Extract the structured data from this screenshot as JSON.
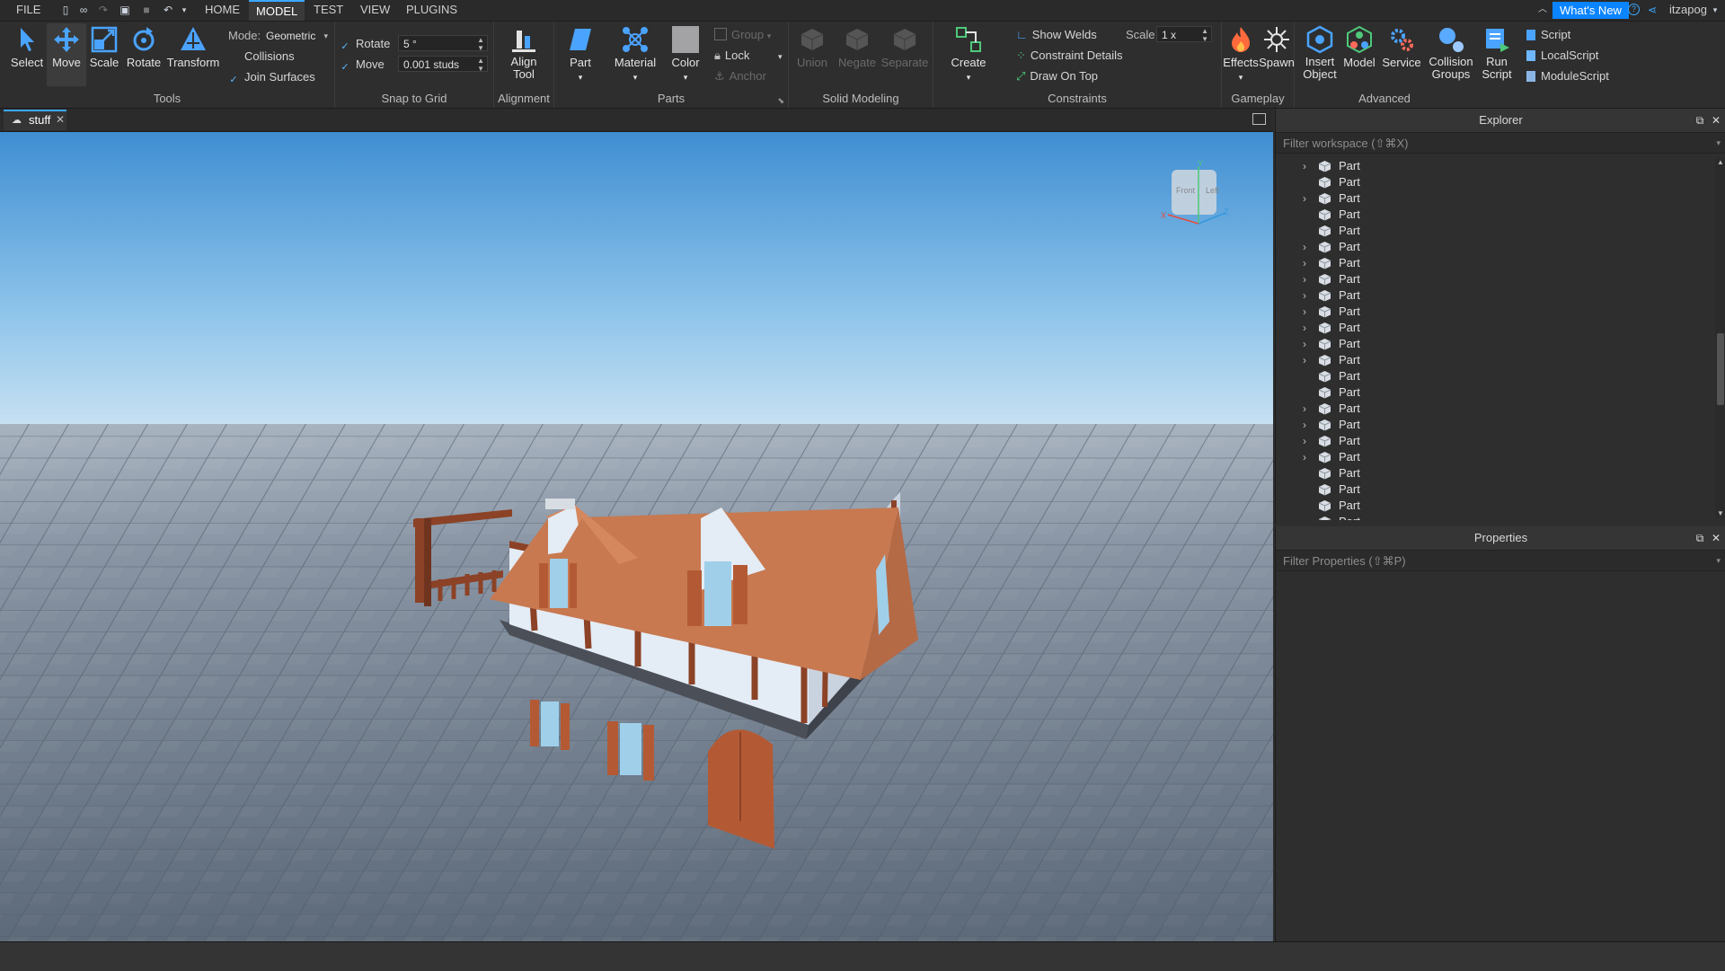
{
  "menubar": {
    "file": "FILE",
    "tabs": [
      "HOME",
      "MODEL",
      "TEST",
      "VIEW",
      "PLUGINS"
    ],
    "active_tab": "MODEL",
    "whats_new": "What's New",
    "username": "itzapog"
  },
  "ribbon": {
    "tools": {
      "label": "Tools",
      "select": "Select",
      "move": "Move",
      "scale": "Scale",
      "rotate": "Rotate",
      "transform": "Transform",
      "mode_label": "Mode:",
      "mode_value": "Geometric",
      "collisions": "Collisions",
      "join_surfaces": "Join Surfaces"
    },
    "snap": {
      "label": "Snap to Grid",
      "rotate_label": "Rotate",
      "rotate_value": "5 °",
      "move_label": "Move",
      "move_value": "0.001 studs"
    },
    "alignment": {
      "label": "Alignment",
      "align_tool_line1": "Align",
      "align_tool_line2": "Tool"
    },
    "parts": {
      "label": "Parts",
      "part": "Part",
      "material": "Material",
      "color": "Color",
      "group": "Group",
      "lock": "Lock",
      "anchor": "Anchor"
    },
    "solid": {
      "label": "Solid Modeling",
      "union": "Union",
      "negate": "Negate",
      "separate": "Separate"
    },
    "constraints": {
      "label": "Constraints",
      "create": "Create",
      "show_welds": "Show Welds",
      "constraint_details": "Constraint Details",
      "draw_on_top": "Draw On Top",
      "scale_label": "Scale",
      "scale_value": "1 x"
    },
    "gameplay": {
      "label": "Gameplay",
      "effects": "Effects",
      "spawn": "Spawn"
    },
    "advanced": {
      "label": "Advanced",
      "insert_object_1": "Insert",
      "insert_object_2": "Object",
      "model": "Model",
      "service": "Service",
      "collision_groups_1": "Collision",
      "collision_groups_2": "Groups",
      "run_script_1": "Run",
      "run_script_2": "Script",
      "script": "Script",
      "local_script": "LocalScript",
      "module_script": "ModuleScript"
    }
  },
  "document_tab": {
    "name": "stuff"
  },
  "viewcube": {
    "front": "Front",
    "left": "Left",
    "x": "X",
    "y": "Y",
    "z": "Z"
  },
  "explorer": {
    "title": "Explorer",
    "filter_placeholder": "Filter workspace (⇧⌘X)",
    "items": [
      {
        "label": "Part",
        "expandable": true
      },
      {
        "label": "Part",
        "expandable": false
      },
      {
        "label": "Part",
        "expandable": true
      },
      {
        "label": "Part",
        "expandable": false
      },
      {
        "label": "Part",
        "expandable": false
      },
      {
        "label": "Part",
        "expandable": true
      },
      {
        "label": "Part",
        "expandable": true
      },
      {
        "label": "Part",
        "expandable": true
      },
      {
        "label": "Part",
        "expandable": true
      },
      {
        "label": "Part",
        "expandable": true
      },
      {
        "label": "Part",
        "expandable": true
      },
      {
        "label": "Part",
        "expandable": true
      },
      {
        "label": "Part",
        "expandable": true
      },
      {
        "label": "Part",
        "expandable": false
      },
      {
        "label": "Part",
        "expandable": false
      },
      {
        "label": "Part",
        "expandable": true
      },
      {
        "label": "Part",
        "expandable": true
      },
      {
        "label": "Part",
        "expandable": true
      },
      {
        "label": "Part",
        "expandable": true
      },
      {
        "label": "Part",
        "expandable": false
      },
      {
        "label": "Part",
        "expandable": false
      },
      {
        "label": "Part",
        "expandable": false
      },
      {
        "label": "Part",
        "expandable": true
      }
    ]
  },
  "properties": {
    "title": "Properties",
    "filter_placeholder": "Filter Properties (⇧⌘P)"
  },
  "colors": {
    "accent": "#3da7ff",
    "whats_new_bg": "#0a84ff",
    "roof": "#c87950",
    "timber": "#8c4226",
    "wall": "#e4ecf5",
    "sky_top": "#3f8ed2",
    "ground": "#6f7c8c"
  }
}
